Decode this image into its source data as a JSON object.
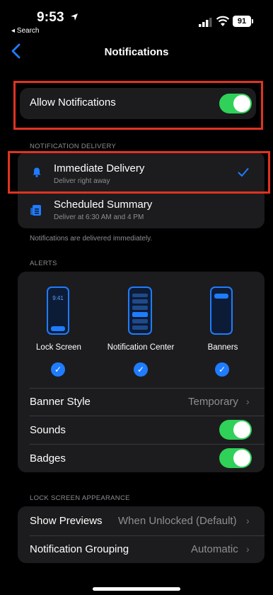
{
  "status": {
    "time": "9:53",
    "back_label": "◂ Search",
    "battery": "91"
  },
  "nav": {
    "title": "Notifications"
  },
  "allow": {
    "label": "Allow Notifications",
    "on": true
  },
  "delivery": {
    "header": "NOTIFICATION DELIVERY",
    "options": [
      {
        "title": "Immediate Delivery",
        "subtitle": "Deliver right away",
        "selected": true
      },
      {
        "title": "Scheduled Summary",
        "subtitle": "Deliver at 6:30 AM and 4 PM",
        "selected": false
      }
    ],
    "footer": "Notifications are delivered immediately."
  },
  "alerts": {
    "header": "ALERTS",
    "styles": [
      {
        "label": "Lock Screen",
        "preview_time": "9:41",
        "checked": true
      },
      {
        "label": "Notification Center",
        "checked": true
      },
      {
        "label": "Banners",
        "checked": true
      }
    ],
    "banner_style": {
      "label": "Banner Style",
      "value": "Temporary"
    },
    "sounds": {
      "label": "Sounds",
      "on": true
    },
    "badges": {
      "label": "Badges",
      "on": true
    }
  },
  "lock_screen": {
    "header": "LOCK SCREEN APPEARANCE",
    "show_previews": {
      "label": "Show Previews",
      "value": "When Unlocked (Default)"
    },
    "grouping": {
      "label": "Notification Grouping",
      "value": "Automatic"
    }
  },
  "colors": {
    "accent": "#1f7cff",
    "toggle_on": "#30d158",
    "highlight": "#e03320"
  }
}
